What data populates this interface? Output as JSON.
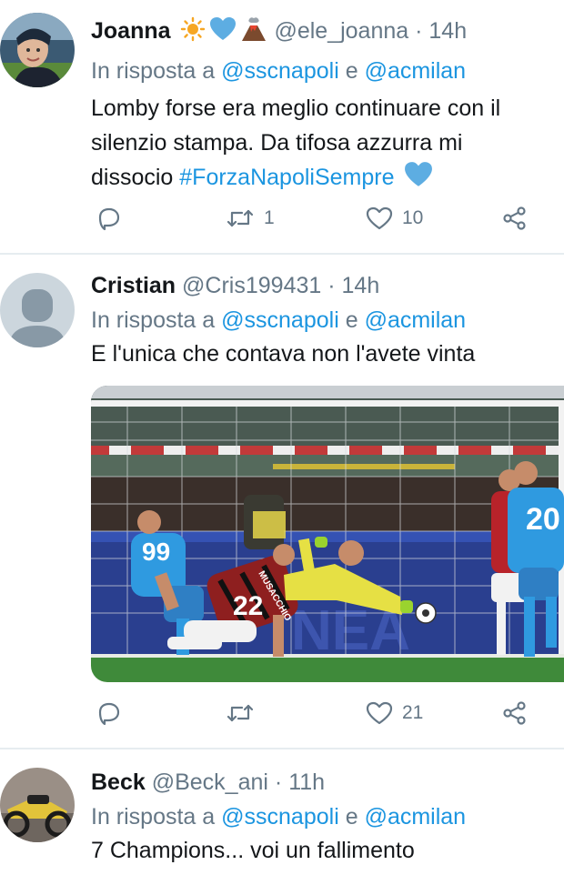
{
  "tweets": [
    {
      "name": "Joanna",
      "handle": "@ele_joanna",
      "sep": "·",
      "time": "14h",
      "reply_prefix": "In risposta a",
      "reply_m1": "@sscnapoli",
      "reply_and": "e",
      "reply_m2": "@acmilan",
      "text_line1": "Lomby forse era meglio continuare con il",
      "text_line2": "silenzio stampa. Da tifosa azzurra mi",
      "text_line3": "dissocio",
      "hashtag": "#ForzaNapoliSempre",
      "retweets": "1",
      "likes": "10"
    },
    {
      "name": "Cristian",
      "handle": "@Cris199431",
      "sep": "·",
      "time": "14h",
      "reply_prefix": "In risposta a",
      "reply_m1": "@sscnapoli",
      "reply_and": "e",
      "reply_m2": "@acmilan",
      "text": "E l'unica che contava non l'avete vinta",
      "media_jersey_99": "99",
      "media_jersey_22": "22",
      "media_jersey_20": "20",
      "media_player_name": "MUSACCHIO",
      "retweets": "",
      "likes": "21"
    },
    {
      "name": "Beck",
      "handle": "@Beck_ani",
      "sep": "·",
      "time": "11h",
      "reply_prefix": "In risposta a",
      "reply_m1": "@sscnapoli",
      "reply_and": "e",
      "reply_m2": "@acmilan",
      "text": "7 Champions... voi un fallimento"
    }
  ],
  "icons": {
    "reply": "reply-icon",
    "retweet": "retweet-icon",
    "like": "heart-icon",
    "share": "share-icon",
    "sun": "sun-emoji-icon",
    "heart_blue": "blue-heart-emoji-icon",
    "volcano": "volcano-emoji-icon"
  },
  "colors": {
    "link": "#1b95e0",
    "muted": "#657786",
    "text": "#14171a",
    "divider": "#e6ecf0"
  }
}
